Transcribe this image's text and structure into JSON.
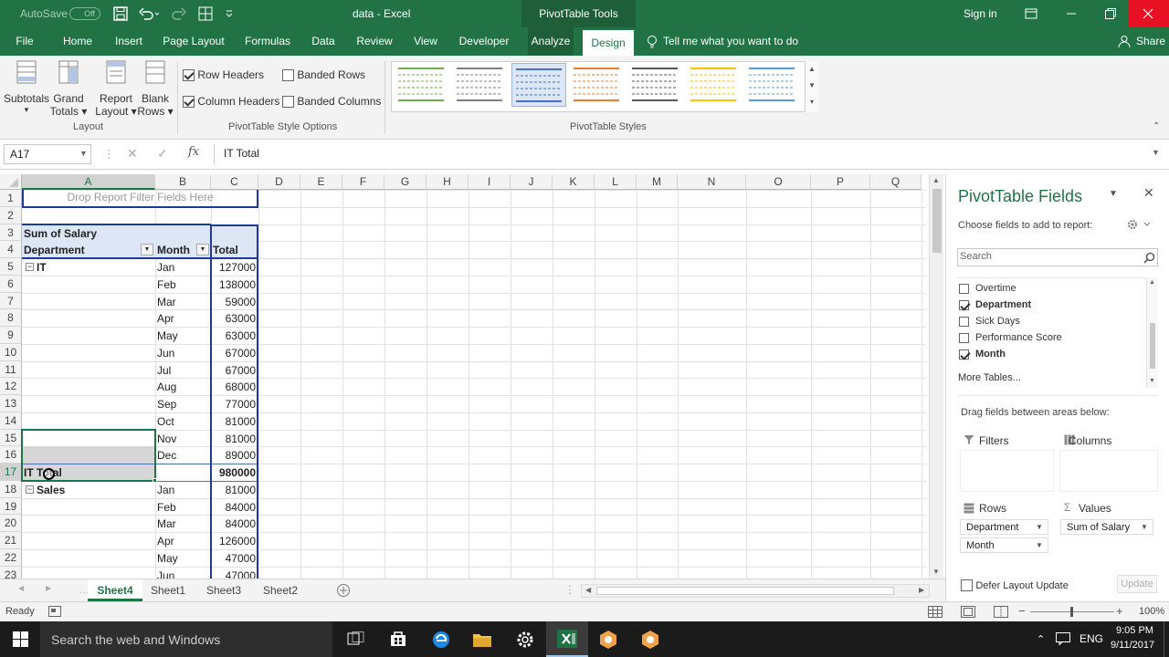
{
  "title_bar": {
    "autosave": "AutoSave",
    "autosave_state": "Off",
    "doc_title": "data  -  Excel",
    "context_title": "PivotTable Tools",
    "signin": "Sign in"
  },
  "ribbon_tabs": [
    "File",
    "Home",
    "Insert",
    "Page Layout",
    "Formulas",
    "Data",
    "Review",
    "View",
    "Developer",
    "Analyze",
    "Design"
  ],
  "active_tab": "Design",
  "tell_me": "Tell me what you want to do",
  "share": "Share",
  "layout_group": {
    "buttons": [
      {
        "line1": "Subtotals",
        "line2": "▾"
      },
      {
        "line1": "Grand",
        "line2": "Totals ▾"
      },
      {
        "line1": "Report",
        "line2": "Layout ▾"
      },
      {
        "line1": "Blank",
        "line2": "Rows ▾"
      }
    ],
    "label": "Layout"
  },
  "style_options": {
    "row_headers": "Row Headers",
    "column_headers": "Column Headers",
    "banded_rows": "Banded Rows",
    "banded_columns": "Banded Columns",
    "label": "PivotTable Style Options"
  },
  "styles_label": "PivotTable Styles",
  "style_colors": [
    "#70ad47",
    "#7f7f7f",
    "#4472c4",
    "#ed7d31",
    "#595959",
    "#ffc000",
    "#5b9bd5"
  ],
  "name_box": "A17",
  "formula": "IT Total",
  "columns": [
    "A",
    "B",
    "C",
    "D",
    "E",
    "F",
    "G",
    "H",
    "I",
    "J",
    "K",
    "L",
    "M",
    "N",
    "O",
    "P",
    "Q"
  ],
  "rows": [
    "1",
    "2",
    "3",
    "4",
    "5",
    "6",
    "7",
    "8",
    "9",
    "10",
    "11",
    "12",
    "13",
    "14",
    "15",
    "16",
    "17",
    "18",
    "19",
    "20",
    "21",
    "22",
    "23"
  ],
  "pivot": {
    "filter_hint": "Drop Report Filter Fields Here",
    "value_field": "Sum of Salary",
    "header_dept": "Department",
    "header_month": "Month",
    "header_total": "Total",
    "dept_it": "IT",
    "it_total_label": "IT Total",
    "it_total_value": "980000",
    "dept_sales": "Sales",
    "it_rows": [
      {
        "month": "Jan",
        "value": "127000"
      },
      {
        "month": "Feb",
        "value": "138000"
      },
      {
        "month": "Mar",
        "value": "59000"
      },
      {
        "month": "Apr",
        "value": "63000"
      },
      {
        "month": "May",
        "value": "63000"
      },
      {
        "month": "Jun",
        "value": "67000"
      },
      {
        "month": "Jul",
        "value": "67000"
      },
      {
        "month": "Aug",
        "value": "68000"
      },
      {
        "month": "Sep",
        "value": "77000"
      },
      {
        "month": "Oct",
        "value": "81000"
      },
      {
        "month": "Nov",
        "value": "81000"
      },
      {
        "month": "Dec",
        "value": "89000"
      }
    ],
    "sales_rows": [
      {
        "month": "Jan",
        "value": "81000"
      },
      {
        "month": "Feb",
        "value": "84000"
      },
      {
        "month": "Mar",
        "value": "84000"
      },
      {
        "month": "Apr",
        "value": "126000"
      },
      {
        "month": "May",
        "value": "47000"
      },
      {
        "month": "Jun",
        "value": "47000"
      }
    ]
  },
  "fields_pane": {
    "title": "PivotTable Fields",
    "subtitle": "Choose fields to add to report:",
    "search_placeholder": "Search",
    "fields": [
      {
        "name": "Overtime",
        "checked": false
      },
      {
        "name": "Department",
        "checked": true
      },
      {
        "name": "Sick Days",
        "checked": false
      },
      {
        "name": "Performance Score",
        "checked": false
      },
      {
        "name": "Month",
        "checked": true
      }
    ],
    "more_tables": "More Tables...",
    "drag_hint": "Drag fields between areas below:",
    "filters_label": "Filters",
    "columns_label": "Columns",
    "rows_label": "Rows",
    "values_label": "Values",
    "rows_fields": [
      "Department",
      "Month"
    ],
    "values_fields": [
      "Sum of Salary"
    ],
    "defer_label": "Defer Layout Update",
    "update_label": "Update"
  },
  "sheet_tabs": [
    "Sheet4",
    "Sheet1",
    "Sheet3",
    "Sheet2"
  ],
  "active_sheet": "Sheet4",
  "status": {
    "ready": "Ready",
    "zoom": "100%"
  },
  "taskbar": {
    "search": "Search the web and Windows",
    "lang": "ENG",
    "time": "9:05 PM",
    "date": "9/11/2017"
  }
}
